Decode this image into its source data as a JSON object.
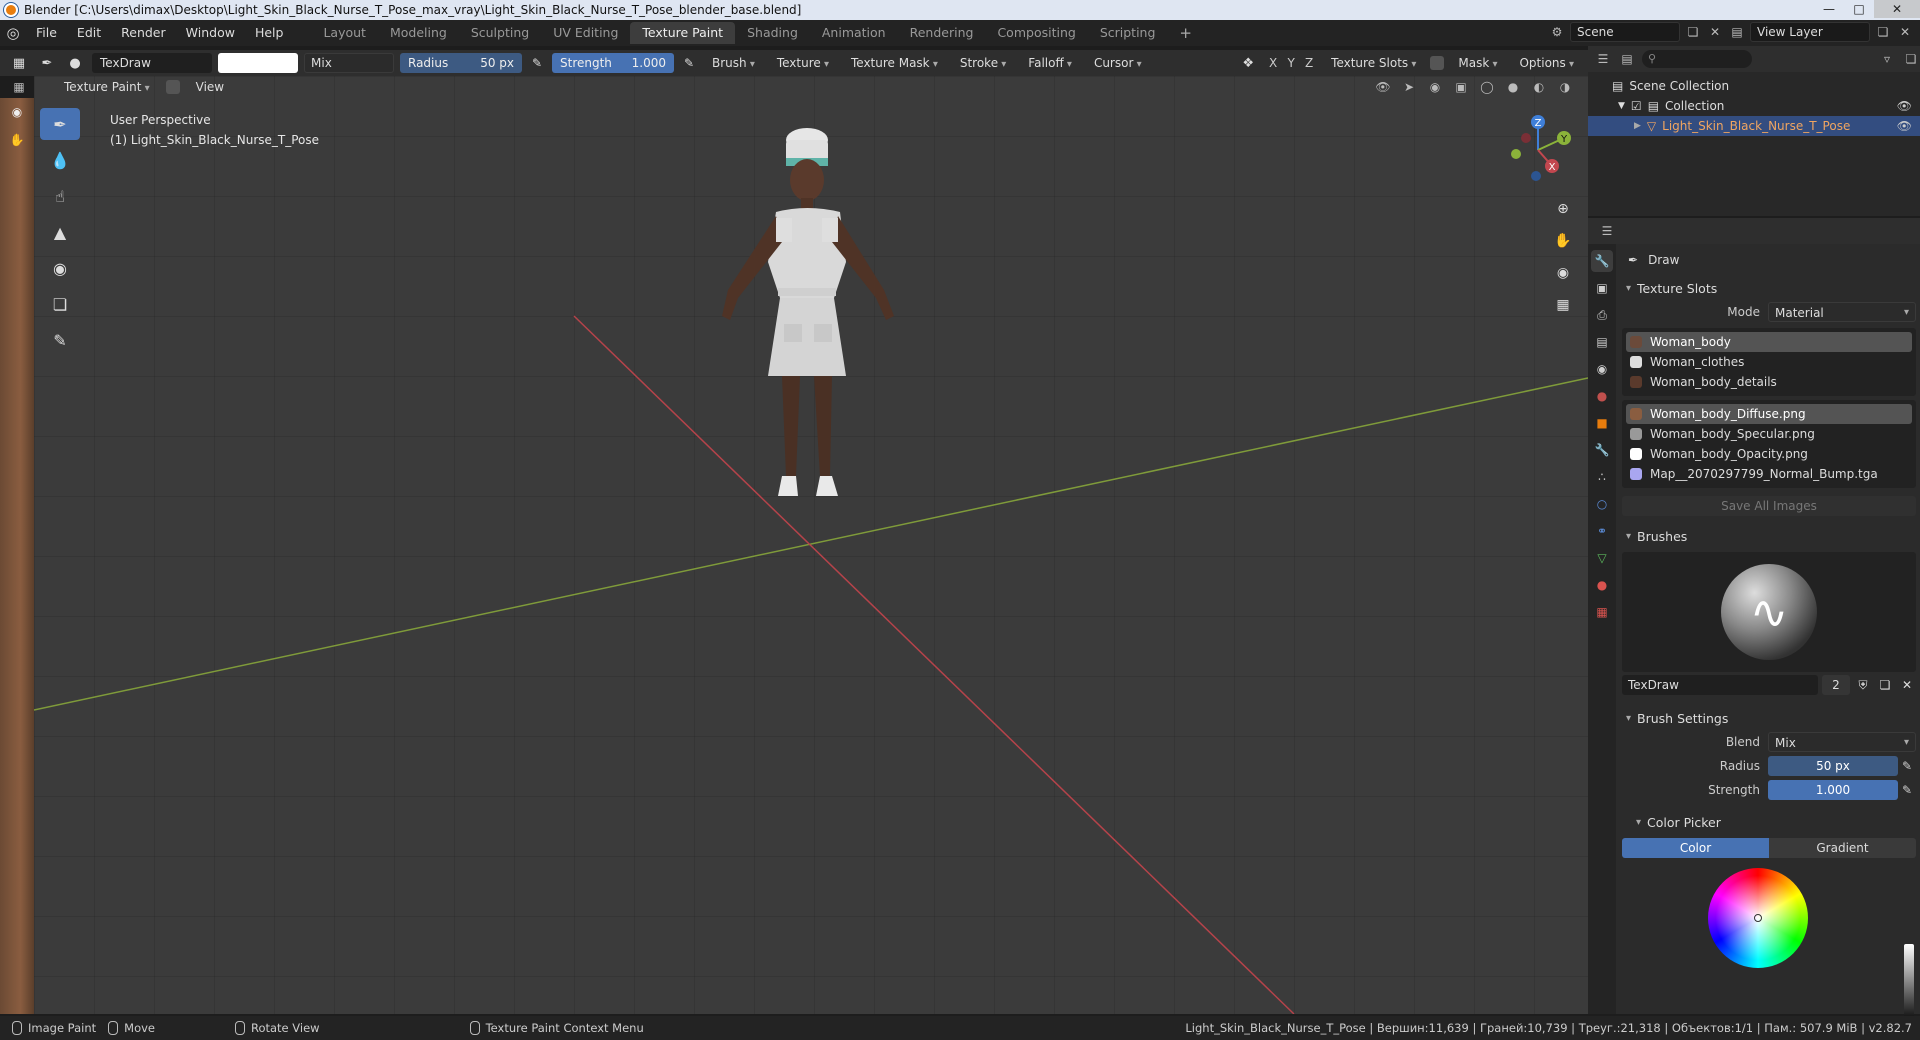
{
  "window": {
    "title": "Blender [C:\\Users\\dimax\\Desktop\\Light_Skin_Black_Nurse_T_Pose_max_vray\\Light_Skin_Black_Nurse_T_Pose_blender_base.blend]",
    "minimize": "—",
    "maximize": "□",
    "close": "✕"
  },
  "menu": {
    "file": "File",
    "edit": "Edit",
    "render": "Render",
    "window": "Window",
    "help": "Help"
  },
  "workspaces": {
    "layout": "Layout",
    "modeling": "Modeling",
    "sculpting": "Sculpting",
    "uv_editing": "UV Editing",
    "texture_paint": "Texture Paint",
    "shading": "Shading",
    "animation": "Animation",
    "rendering": "Rendering",
    "compositing": "Compositing",
    "scripting": "Scripting",
    "add": "+"
  },
  "scene": {
    "name": "Scene",
    "view_layer": "View Layer"
  },
  "tool_header": {
    "brush_name": "TexDraw",
    "blend": "Mix",
    "radius_label": "Radius",
    "radius_value": "50 px",
    "strength_label": "Strength",
    "strength_value": "1.000",
    "brush": "Brush",
    "texture": "Texture",
    "texture_mask": "Texture Mask",
    "stroke": "Stroke",
    "falloff": "Falloff",
    "cursor": "Cursor",
    "x": "X",
    "y": "Y",
    "z": "Z",
    "texture_slots": "Texture Slots",
    "mask": "Mask",
    "options": "Options"
  },
  "viewport_header": {
    "mode": "Texture Paint",
    "view": "View"
  },
  "viewport": {
    "perspective": "User Perspective",
    "object_label": "(1) Light_Skin_Black_Nurse_T_Pose",
    "gizmo": {
      "x": "X",
      "y": "Y",
      "z": "Z"
    }
  },
  "outliner": {
    "scene_collection": "Scene Collection",
    "collection": "Collection",
    "object": "Light_Skin_Black_Nurse_T_Pose"
  },
  "properties": {
    "tool_title": "Draw",
    "texture_slots": {
      "header": "Texture Slots",
      "mode_label": "Mode",
      "mode_value": "Material",
      "materials": [
        "Woman_body",
        "Woman_clothes",
        "Woman_body_details"
      ],
      "images": [
        "Woman_body_Diffuse.png",
        "Woman_body_Specular.png",
        "Woman_body_Opacity.png",
        "Map__2070297799_Normal_Bump.tga"
      ],
      "save_all": "Save All Images"
    },
    "brushes": {
      "header": "Brushes",
      "name": "TexDraw",
      "users": "2"
    },
    "brush_settings": {
      "header": "Brush Settings",
      "blend_label": "Blend",
      "blend_value": "Mix",
      "radius_label": "Radius",
      "radius_value": "50 px",
      "strength_label": "Strength",
      "strength_value": "1.000"
    },
    "color_picker": {
      "header": "Color Picker",
      "color_tab": "Color",
      "gradient_tab": "Gradient"
    }
  },
  "statusbar": {
    "image_paint": "Image Paint",
    "move": "Move",
    "rotate": "Rotate View",
    "context_menu": "Texture Paint Context Menu",
    "stats": "Light_Skin_Black_Nurse_T_Pose | Вершин:11,639 | Граней:10,739 | Треуг.:21,318 | Объектов:1/1 | Пам.: 507.9 MiB | v2.82.7"
  },
  "colors": {
    "accent": "#4772b3",
    "active_object": "#f0a560",
    "x_axis": "#c2474f",
    "y_axis": "#8bb33a",
    "z_axis": "#3f7fd8"
  }
}
